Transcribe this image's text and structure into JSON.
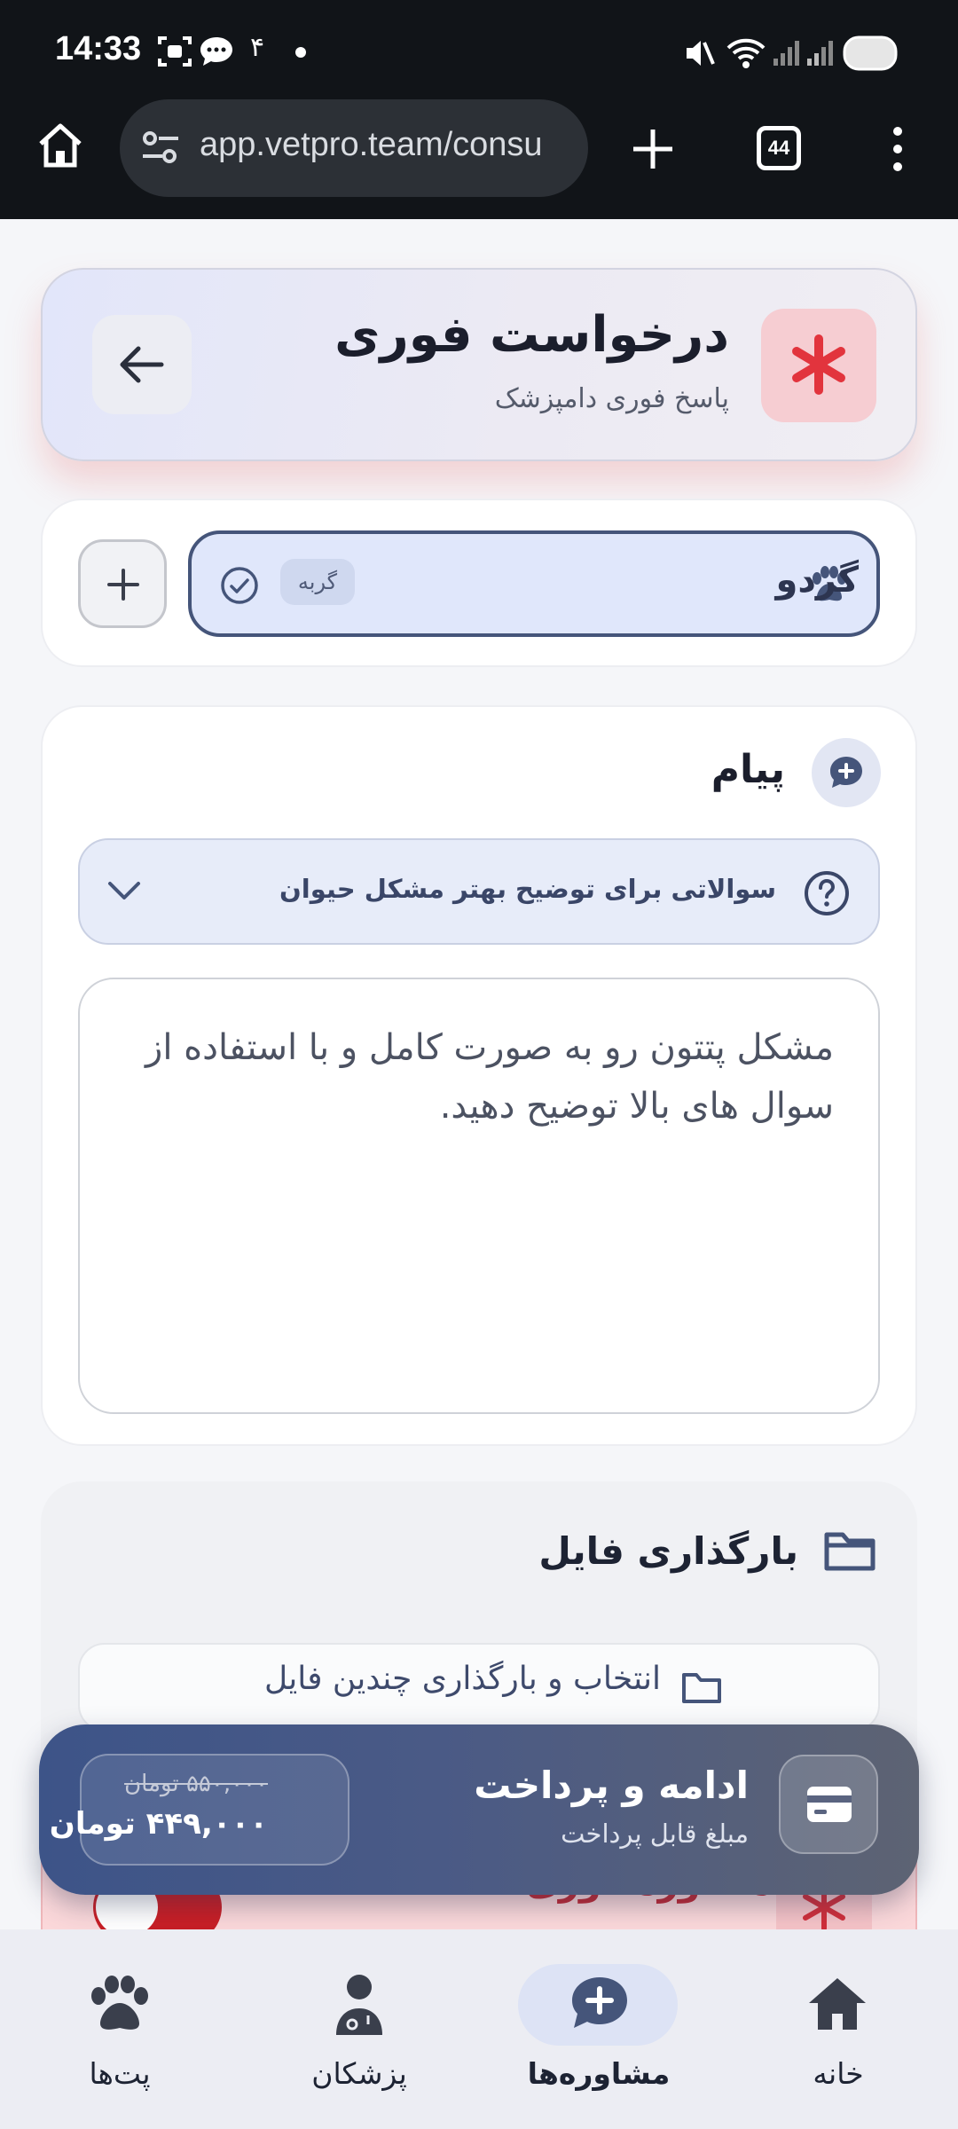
{
  "status_bar": {
    "time": "14:33",
    "notification_count": "۴"
  },
  "browser": {
    "url": "app.vetpro.team/consu",
    "tab_count": "44"
  },
  "header": {
    "title": "درخواست فوری",
    "subtitle": "پاسخ فوری دامپزشک"
  },
  "pet": {
    "name": "گردو",
    "species": "گربه"
  },
  "message": {
    "title": "پیام",
    "questions_label": "سوالاتی برای توضیح بهتر مشکل حیوان",
    "placeholder": "مشکل پتتون رو به صورت کامل و با استفاده از سوال های بالا توضیح دهید."
  },
  "upload": {
    "title": "بارگذاری فایل",
    "button_label": "انتخاب و بارگذاری چندین فایل"
  },
  "emergency_banner": {
    "title": "مشاوره فوری"
  },
  "payment": {
    "title": "ادامه و پرداخت",
    "subtitle": "مبلغ قابل پرداخت",
    "old_price": "۵۵۰,۰۰۰ تومان",
    "new_price": "۴۴۹,۰۰۰ تومان"
  },
  "bottom_nav": {
    "items": [
      {
        "label": "خانه",
        "icon": "home-icon"
      },
      {
        "label": "مشاوره‌ها",
        "icon": "chat-plus-icon",
        "active": true
      },
      {
        "label": "پزشکان",
        "icon": "doctor-icon"
      },
      {
        "label": "پت‌ها",
        "icon": "paw-icon"
      }
    ]
  },
  "colors": {
    "accent": "#45557a",
    "emergency": "#e2343d",
    "pay_bar": "#3d5488"
  }
}
